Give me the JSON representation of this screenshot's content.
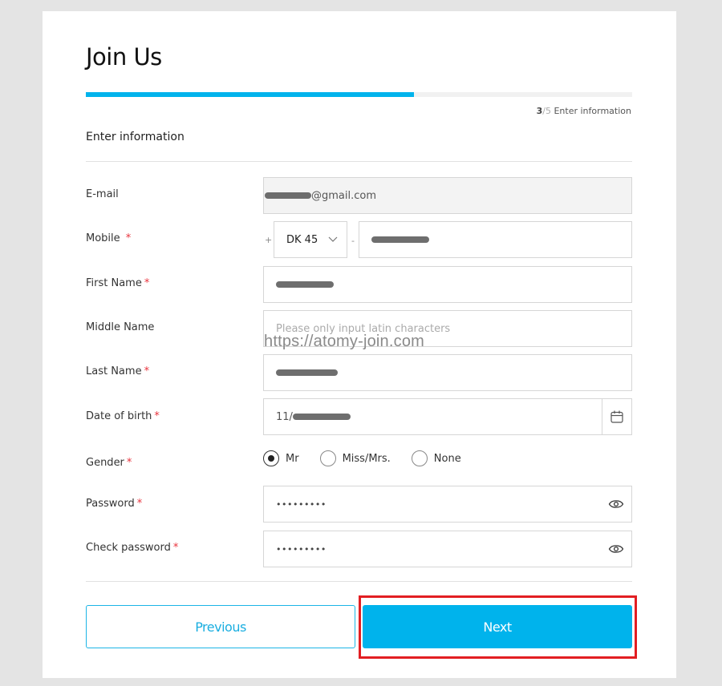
{
  "page": {
    "title": "Join Us",
    "progress": {
      "current_step": 3,
      "total_steps": 5,
      "fraction": 0.6,
      "current_label": "3",
      "total_label": "/5",
      "step_name": "Enter information"
    },
    "section_title": "Enter information",
    "watermark": "https://atomy-join.com"
  },
  "form": {
    "email": {
      "label": "E-mail",
      "value_suffix": "@gmail.com",
      "disabled": true
    },
    "mobile": {
      "label": "Mobile",
      "required_mark": "*",
      "plus": "+",
      "dash": "-",
      "country_code": "DK 45",
      "number": ""
    },
    "first_name": {
      "label": "First Name",
      "required_mark": "*",
      "value": ""
    },
    "middle_name": {
      "label": "Middle Name",
      "placeholder": "Please only input latin characters"
    },
    "last_name": {
      "label": "Last Name",
      "required_mark": "*",
      "value": ""
    },
    "date_of_birth": {
      "label": "Date of birth",
      "required_mark": "*",
      "value_prefix": "11/"
    },
    "gender": {
      "label": "Gender",
      "required_mark": "*",
      "options": [
        {
          "label": "Mr",
          "checked": true
        },
        {
          "label": "Miss/Mrs.",
          "checked": false
        },
        {
          "label": "None",
          "checked": false
        }
      ]
    },
    "password": {
      "label": "Password",
      "required_mark": "*",
      "masked": "•••••••••"
    },
    "check_password": {
      "label": "Check password",
      "required_mark": "*",
      "masked": "•••••••••"
    }
  },
  "buttons": {
    "previous": "Previous",
    "next": "Next"
  },
  "colors": {
    "accent": "#00b3ec",
    "required": "#e8323c",
    "highlight": "#e21e22"
  }
}
